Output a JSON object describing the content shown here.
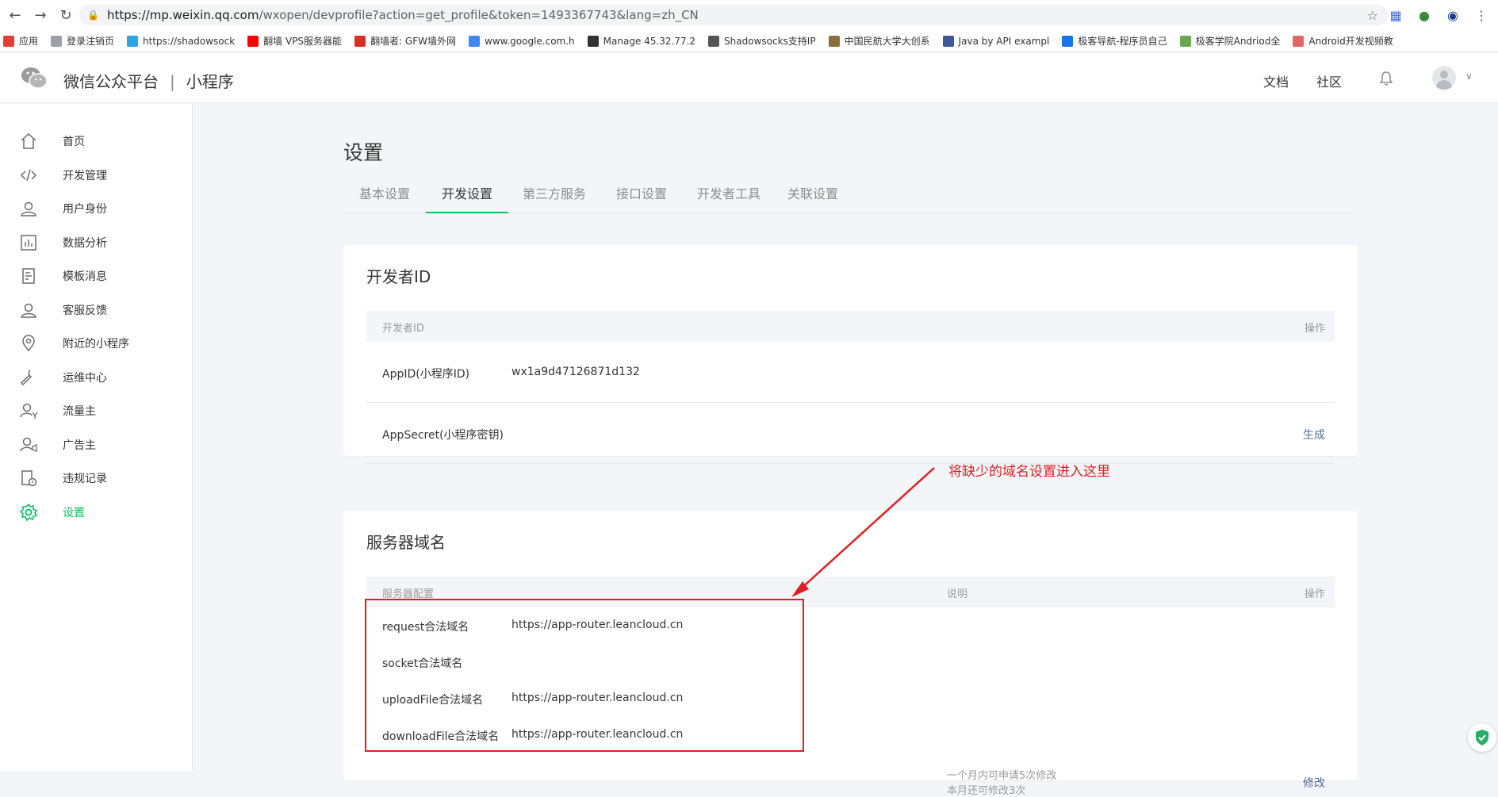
{
  "browser": {
    "url_host": "https://mp.weixin.qq.com",
    "url_path": "/wxopen/devprofile?action=get_profile&token=1493367743&lang=zh_CN",
    "bookmarks": [
      {
        "label": "应用",
        "color": "#e34133"
      },
      {
        "label": "登录注销页",
        "color": "#9aa0a6"
      },
      {
        "label": "https://shadowsock",
        "color": "#2ca5e0"
      },
      {
        "label": "翻墙 VPS服务器能",
        "color": "#ff0000"
      },
      {
        "label": "翻墙者: GFW墙外网",
        "color": "#d93025"
      },
      {
        "label": "www.google.com.h",
        "color": "#4285f4"
      },
      {
        "label": "Manage 45.32.77.2",
        "color": "#333333"
      },
      {
        "label": "Shadowsocks支持IP",
        "color": "#555555"
      },
      {
        "label": "中国民航大学大创系",
        "color": "#8a6d3b"
      },
      {
        "label": "Java by API exampl",
        "color": "#3b5998"
      },
      {
        "label": "极客导航-程序员自己",
        "color": "#1a73e8"
      },
      {
        "label": "极客学院Andriod全",
        "color": "#6aa84f"
      },
      {
        "label": "Android开发视频教",
        "color": "#e06666"
      }
    ]
  },
  "header": {
    "brand": "微信公众平台",
    "separator": "|",
    "product": "小程序",
    "docs_link": "文档",
    "community_link": "社区"
  },
  "sidebar": {
    "items": [
      {
        "label": "首页",
        "icon": "home-icon"
      },
      {
        "label": "开发管理",
        "icon": "code-icon"
      },
      {
        "label": "用户身份",
        "icon": "user-icon"
      },
      {
        "label": "数据分析",
        "icon": "chart-icon"
      },
      {
        "label": "模板消息",
        "icon": "document-icon"
      },
      {
        "label": "客服反馈",
        "icon": "service-icon"
      },
      {
        "label": "附近的小程序",
        "icon": "location-icon"
      },
      {
        "label": "运维中心",
        "icon": "wrench-icon"
      },
      {
        "label": "流量主",
        "icon": "traffic-icon"
      },
      {
        "label": "广告主",
        "icon": "advertiser-icon"
      },
      {
        "label": "违规记录",
        "icon": "violation-icon"
      },
      {
        "label": "设置",
        "icon": "gear-icon",
        "active": true
      }
    ]
  },
  "main": {
    "title": "设置",
    "tabs": [
      "基本设置",
      "开发设置",
      "第三方服务",
      "接口设置",
      "开发者工具",
      "关联设置"
    ],
    "active_tab": "开发设置",
    "developer_id": {
      "title": "开发者ID",
      "col_id": "开发者ID",
      "col_op": "操作",
      "appid_label": "AppID(小程序ID)",
      "appid_value": "wx1a9d47126871d132",
      "secret_label": "AppSecret(小程序密钥)",
      "secret_action": "生成"
    },
    "server_domain": {
      "title": "服务器域名",
      "col_config": "服务器配置",
      "col_desc": "说明",
      "col_op": "操作",
      "rows": [
        {
          "label": "request合法域名",
          "value": "https://app-router.leancloud.cn"
        },
        {
          "label": "socket合法域名",
          "value": ""
        },
        {
          "label": "uploadFile合法域名",
          "value": "https://app-router.leancloud.cn"
        },
        {
          "label": "downloadFile合法域名",
          "value": "https://app-router.leancloud.cn"
        }
      ],
      "note_line1": "一个月内可申请5次修改",
      "note_line2": "本月还可修改3次",
      "modify_action": "修改"
    }
  },
  "annotation": {
    "text": "将缺少的域名设置进入这里",
    "color": "#e02020"
  },
  "colors": {
    "accent": "#07c160",
    "link": "#576b95"
  }
}
